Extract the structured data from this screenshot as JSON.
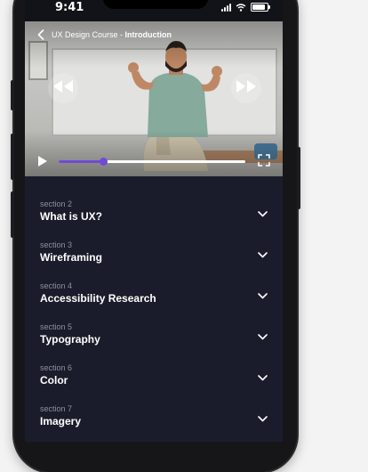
{
  "status": {
    "time": "9:41"
  },
  "video": {
    "course_name": "UX Design Course",
    "separator": " - ",
    "lesson": "Introduction",
    "progress": 0.24
  },
  "sections": [
    {
      "label": "section 2",
      "title": "What is UX?"
    },
    {
      "label": "section 3",
      "title": "Wireframing"
    },
    {
      "label": "section 4",
      "title": "Accessibility Research"
    },
    {
      "label": "section 5",
      "title": "Typography"
    },
    {
      "label": "section 6",
      "title": "Color"
    },
    {
      "label": "section 7",
      "title": "Imagery"
    }
  ],
  "icons": [
    "back-icon",
    "skip-back-icon",
    "skip-forward-icon",
    "play-icon",
    "fullscreen-icon",
    "chevron-down-icon",
    "signal-icon",
    "wifi-icon",
    "battery-icon"
  ],
  "colors": {
    "accent": "#6f4bd8",
    "panel": "#1b1c2b",
    "muted_text": "#8d8fa1"
  }
}
